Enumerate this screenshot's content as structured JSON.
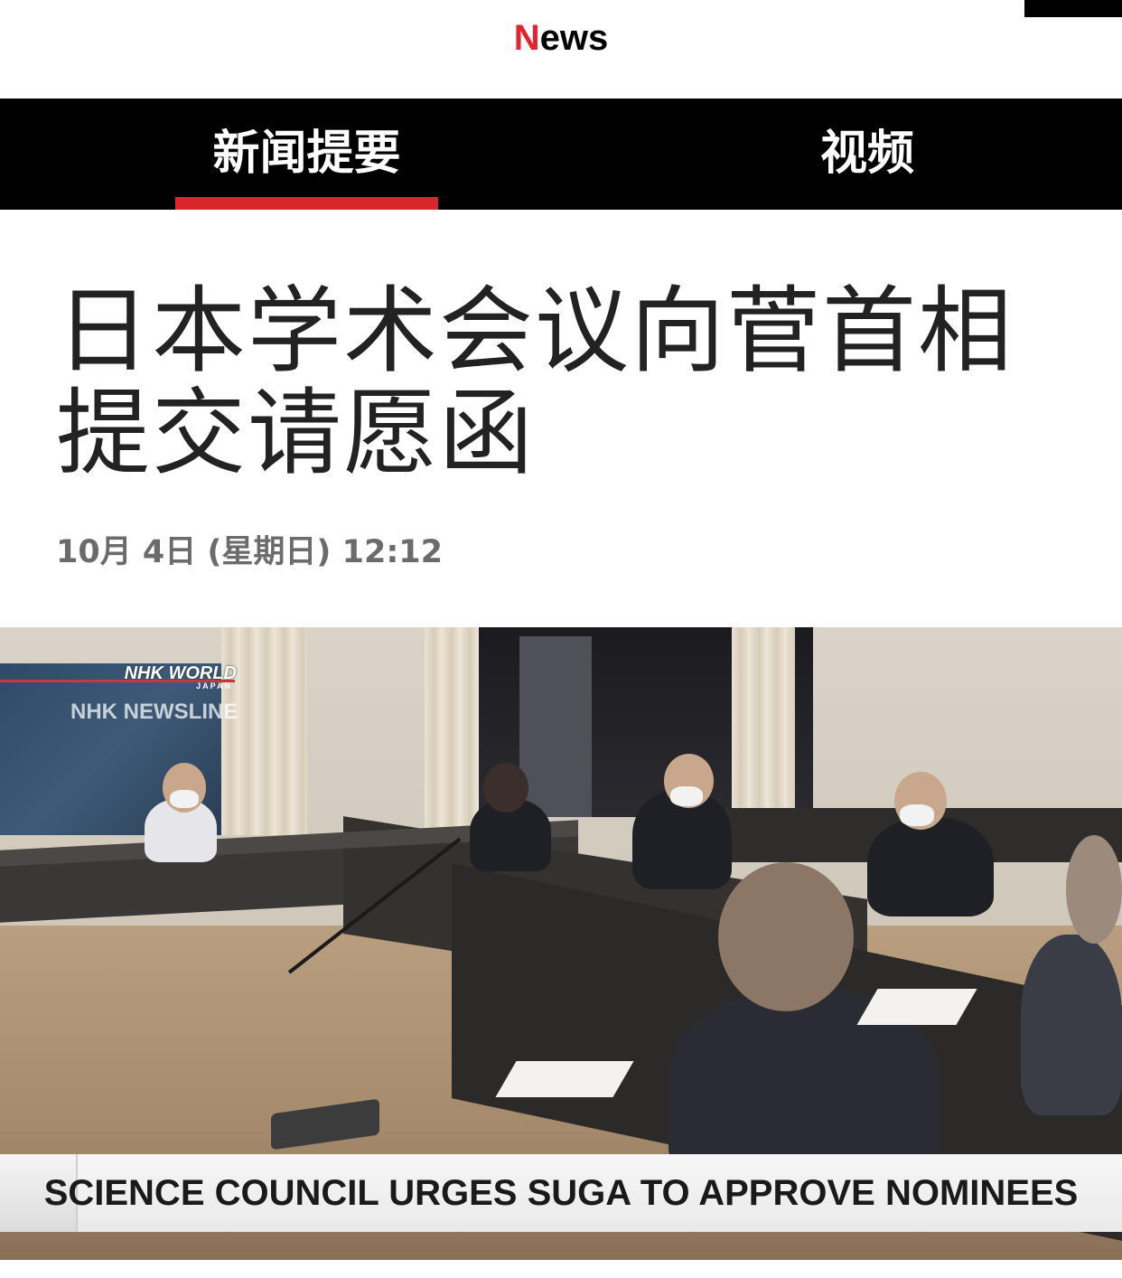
{
  "header": {
    "logo_first": "N",
    "logo_rest": "ews"
  },
  "tabs": [
    {
      "label": "新闻提要",
      "active": true
    },
    {
      "label": "视频",
      "active": false
    }
  ],
  "article": {
    "headline": "日本学术会议向菅首相提交请愿函",
    "timestamp": "10月 4日 (星期日) 12:12"
  },
  "video": {
    "overlay_brand": "NHK WORLD",
    "overlay_brand_sub": "JAPAN",
    "overlay_program": "NHK NEWSLINE",
    "caption": "SCIENCE COUNCIL URGES SUGA TO APPROVE NOMINEES"
  },
  "colors": {
    "accent_red": "#d9262a",
    "tabbar_bg": "#000000",
    "headline_text": "#222222",
    "timestamp_text": "#6b6b6b"
  }
}
